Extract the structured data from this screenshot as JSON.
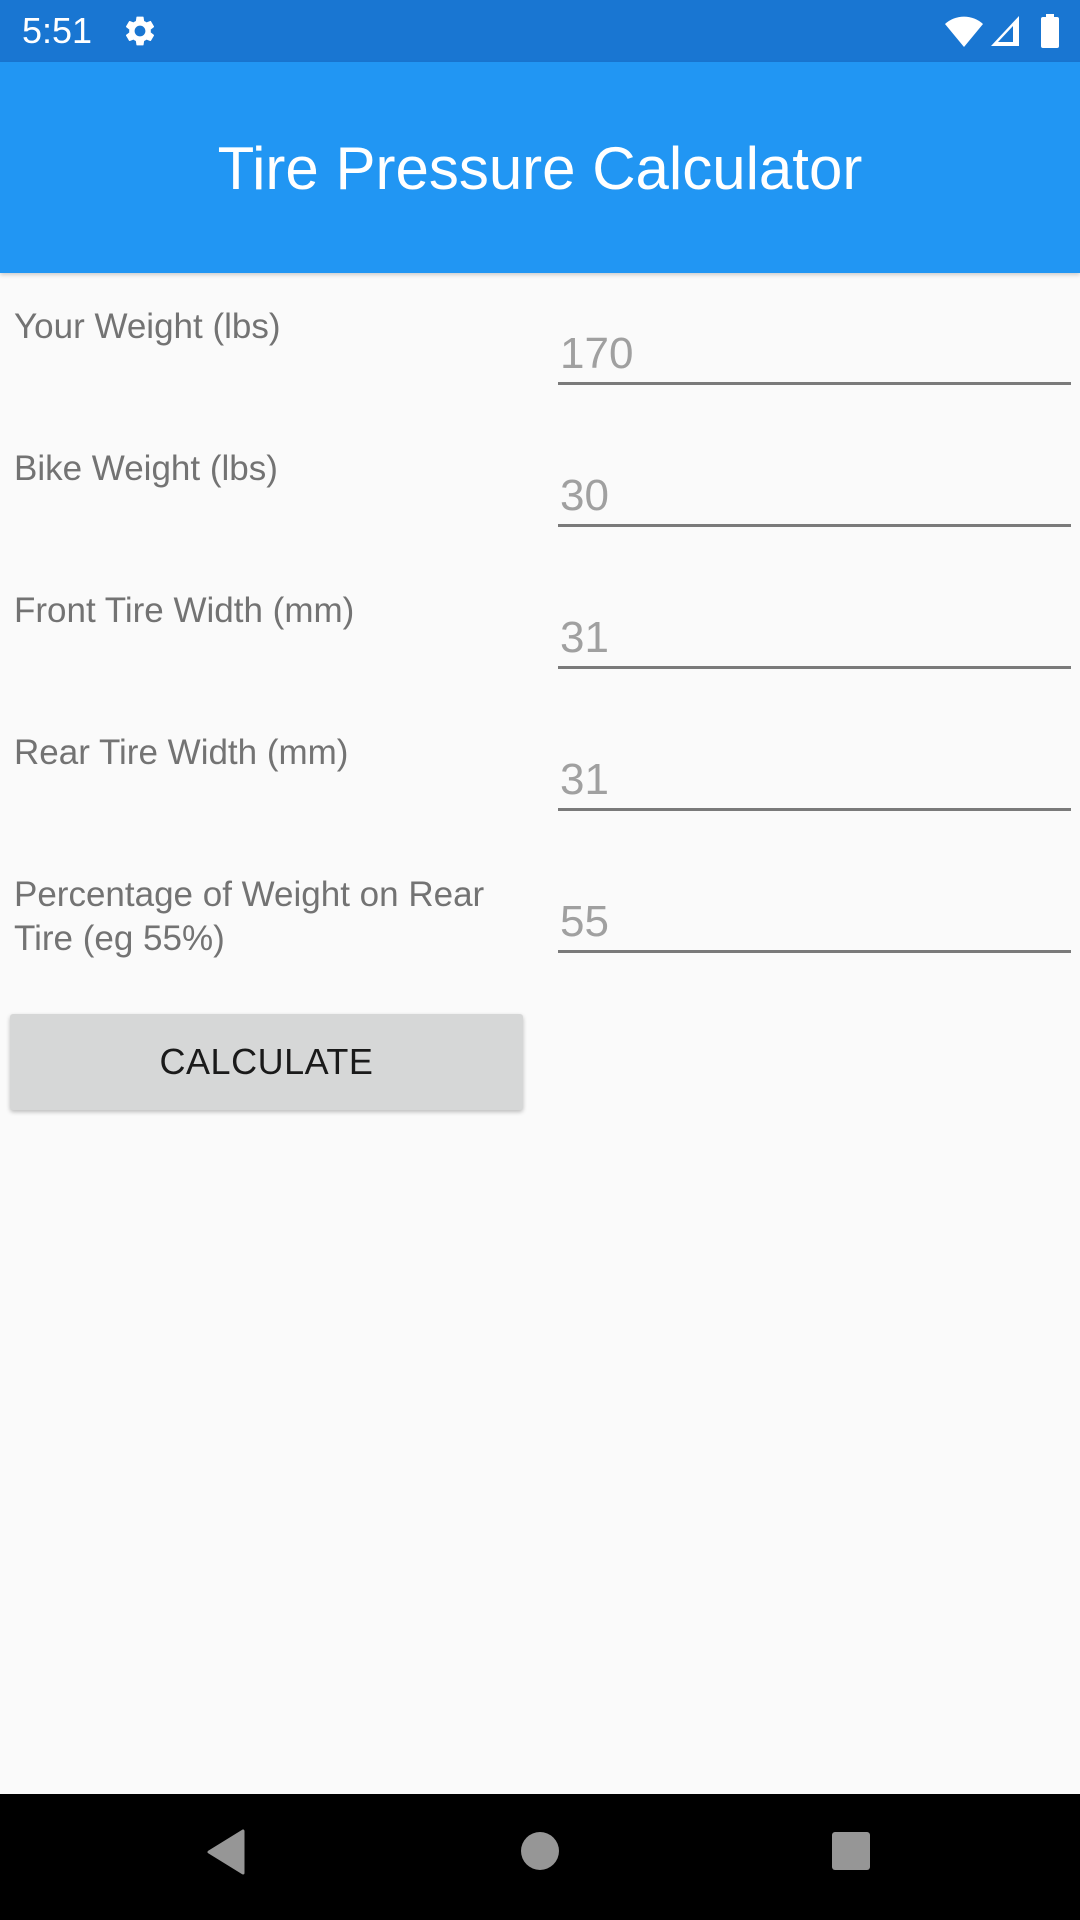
{
  "status_bar": {
    "time": "5:51",
    "icons": [
      "gear-icon",
      "wifi-icon",
      "signal-icon",
      "battery-icon"
    ]
  },
  "app_bar": {
    "title": "Tire Pressure Calculator"
  },
  "form": {
    "fields": [
      {
        "label": "Your Weight (lbs)",
        "value": "",
        "placeholder": "170"
      },
      {
        "label": "Bike Weight (lbs)",
        "value": "",
        "placeholder": "30"
      },
      {
        "label": "Front Tire Width (mm)",
        "value": "",
        "placeholder": "31"
      },
      {
        "label": "Rear Tire Width (mm)",
        "value": "",
        "placeholder": "31"
      },
      {
        "label": "Percentage of Weight on Rear Tire (eg 55%)",
        "value": "",
        "placeholder": "55"
      }
    ],
    "calculate_label": "CALCULATE"
  },
  "nav_bar": {
    "buttons": [
      "back",
      "home",
      "recents"
    ]
  },
  "colors": {
    "status_bar": "#1976d2",
    "app_bar": "#2196f3",
    "button_bg": "#d6d7d7"
  }
}
